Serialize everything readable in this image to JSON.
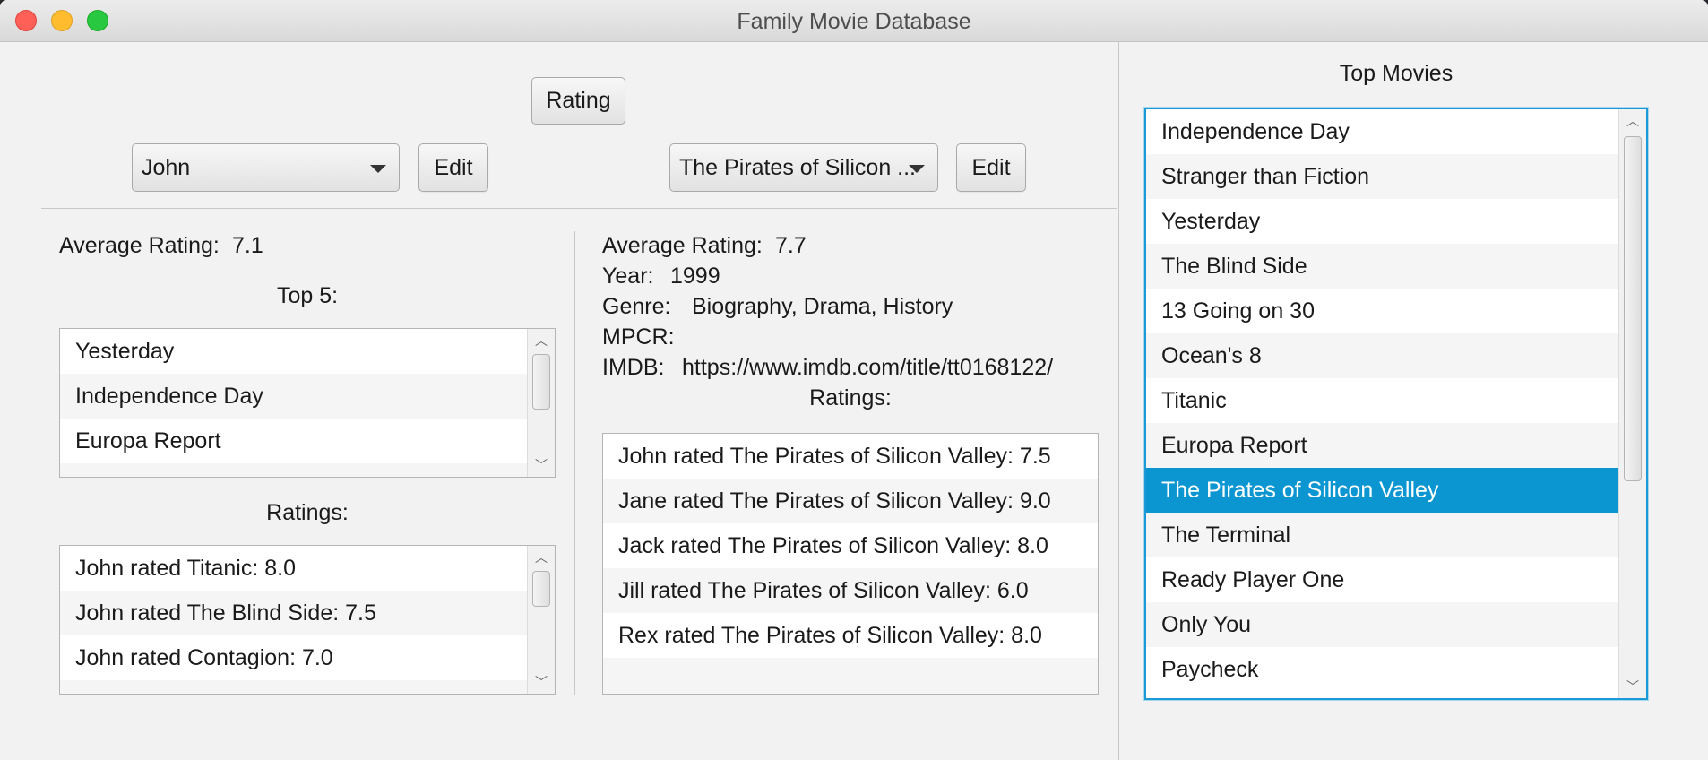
{
  "window": {
    "title": "Family Movie Database"
  },
  "toolbar": {
    "rating_button": "Rating"
  },
  "user_panel": {
    "selected_user": "John",
    "edit_label": "Edit",
    "avg_label": "Average Rating:",
    "avg_value": "7.1",
    "top5_label": "Top 5:",
    "top5_items": [
      "Yesterday",
      "Independence Day",
      "Europa Report"
    ],
    "ratings_label": "Ratings:",
    "ratings_items": [
      "John rated Titanic: 8.0",
      "John rated The Blind Side: 7.5",
      "John rated Contagion: 7.0"
    ]
  },
  "movie_panel": {
    "selected_movie": "The Pirates of Silicon ...",
    "edit_label": "Edit",
    "avg_label": "Average Rating:",
    "avg_value": "7.7",
    "year_label": "Year:",
    "year_value": "1999",
    "genre_label": "Genre:",
    "genre_value": "Biography, Drama, History",
    "mpcr_label": "MPCR:",
    "imdb_label": "IMDB:",
    "imdb_value": "https://www.imdb.com/title/tt0168122/",
    "ratings_label": "Ratings:",
    "ratings_items": [
      "John rated The Pirates of Silicon Valley: 7.5",
      "Jane rated The Pirates of Silicon Valley: 9.0",
      "Jack rated The Pirates of Silicon Valley: 8.0",
      "Jill rated The Pirates of Silicon Valley: 6.0",
      "Rex rated The Pirates of Silicon Valley: 8.0"
    ]
  },
  "top_movies": {
    "label": "Top Movies",
    "selected_index": 8,
    "items": [
      "Independence Day",
      "Stranger than Fiction",
      "Yesterday",
      "The Blind Side",
      "13 Going on 30",
      "Ocean's 8",
      "Titanic",
      "Europa Report",
      "The Pirates of Silicon Valley",
      "The Terminal",
      "Ready Player One",
      "Only You",
      "Paycheck"
    ]
  },
  "colors": {
    "selection": "#0b96d2",
    "focus_border": "#1a9bd7"
  }
}
